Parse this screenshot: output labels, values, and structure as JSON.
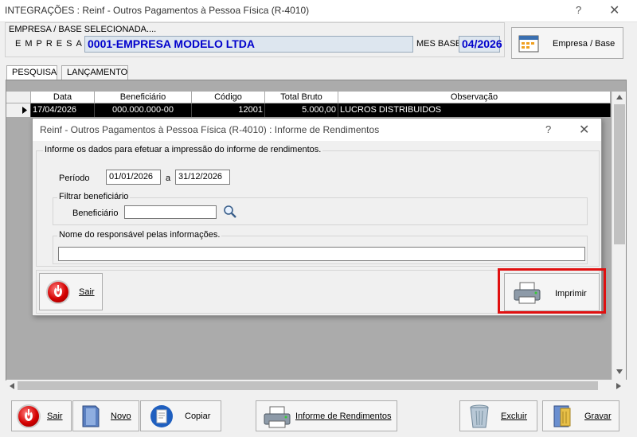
{
  "window": {
    "title": "INTEGRAÇÕES : Reinf - Outros Pagamentos à Pessoa Física (R-4010)",
    "help": "?",
    "close": "✕"
  },
  "empresa": {
    "base_label": "EMPRESA  /  BASE  SELECIONADA....",
    "empresa_label": "EMPRESA",
    "empresa_value": "0001-EMPRESA MODELO LTDA",
    "mes_label": "MES BASE",
    "mes_value": "04/2026",
    "button_label": "Empresa / Base"
  },
  "tabs": [
    {
      "label": "PESQUISA"
    },
    {
      "label": "LANÇAMENTO"
    }
  ],
  "grid": {
    "columns": [
      "Data",
      "Beneficiário",
      "Código",
      "Total Bruto",
      "Observação"
    ],
    "rows": [
      [
        "17/04/2026",
        "000.000.000-00",
        "12001",
        "5.000,00",
        "LUCROS DISTRIBUIDOS"
      ]
    ]
  },
  "dialog": {
    "title": "Reinf - Outros Pagamentos à Pessoa Física (R-4010) : Informe de Rendimentos",
    "help": "?",
    "close": "✕",
    "instructions": "Informe os dados para efetuar a impressão do informe de rendimentos.",
    "periodo_label": "Período",
    "periodo_start": "01/01/2026",
    "periodo_sep": "a",
    "periodo_end": "31/12/2026",
    "filtro_legend": "Filtrar beneficiário",
    "beneficiario_label": "Beneficiário",
    "beneficiario_value": "",
    "responsavel_legend": "Nome do responsável pelas informações.",
    "responsavel_value": "",
    "sair_label": "Sair",
    "imprimir_label": "Imprimir"
  },
  "toolbar": {
    "sair": "Sair",
    "novo": "Novo",
    "copiar": "Copiar",
    "informe": "Informe de Rendimentos",
    "excluir": "Excluir",
    "gravar": "Gravar"
  },
  "colors": {
    "accent_text": "#0000cc",
    "highlight": "#e01010",
    "selected_row": "#000000"
  }
}
